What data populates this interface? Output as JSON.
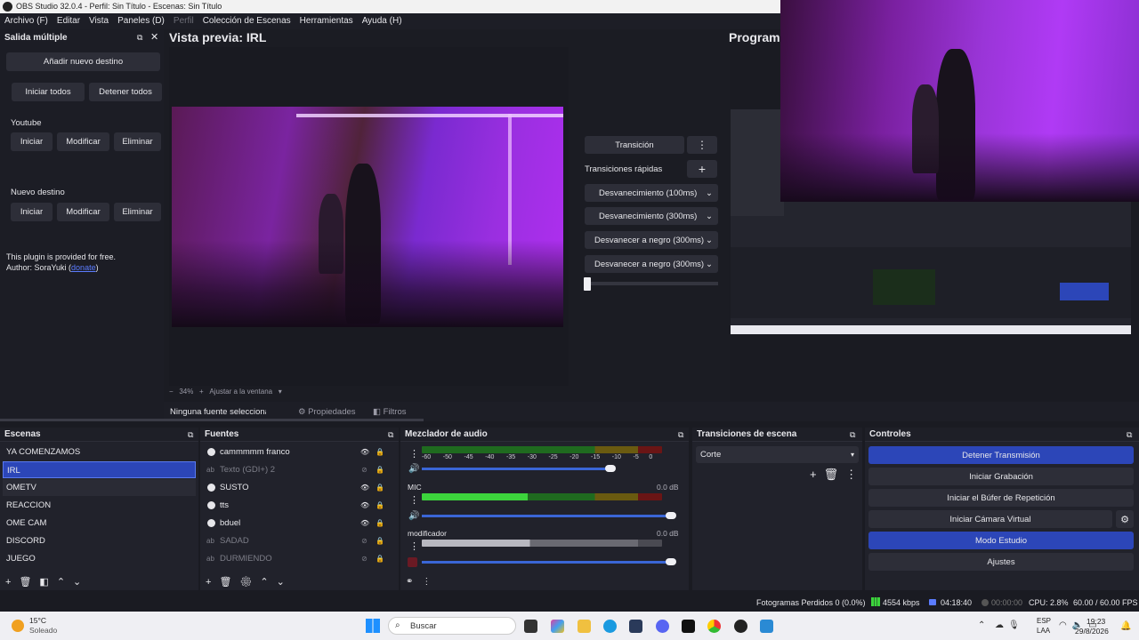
{
  "window": {
    "title": "OBS Studio 32.0.4 - Perfil: Sin Título - Escenas: Sin Título"
  },
  "menu": [
    "Archivo (F)",
    "Editar",
    "Vista",
    "Paneles (D)",
    "Perfil",
    "Colección de Escenas",
    "Herramientas",
    "Ayuda (H)"
  ],
  "multi_output": {
    "title": "Salida múltiple",
    "add_label": "Añadir nuevo destino",
    "start_all": "Iniciar todos",
    "stop_all": "Detener todos",
    "targets": [
      {
        "name": "Youtube",
        "start": "Iniciar",
        "modify": "Modificar",
        "remove": "Eliminar"
      },
      {
        "name": "Nuevo destino",
        "start": "Iniciar",
        "modify": "Modificar",
        "remove": "Eliminar"
      }
    ],
    "note1": "This plugin is provided for free.",
    "note2": "Author: SoraYuki (",
    "donate": "donate",
    "note_end": ")"
  },
  "preview": {
    "title": "Vista previa: IRL",
    "zoom": "34%",
    "fit": "Ajustar a la ventana"
  },
  "program": {
    "title": "Program"
  },
  "transition_center": {
    "transition": "Transición",
    "quick": "Transiciones rápidas",
    "items": [
      "Desvanecimiento (100ms)",
      "Desvanecimiento (300ms)",
      "Desvanecer a negro (300ms)",
      "Desvanecer a negro (300ms)"
    ]
  },
  "source_bar": {
    "none": "Ninguna fuente seleccionad",
    "properties": "Propiedades",
    "filters": "Filtros"
  },
  "scenes": {
    "title": "Escenas",
    "items": [
      "YA COMENZAMOS",
      "IRL",
      "OMETV",
      "REACCION",
      "OME CAM",
      "DISCORD",
      "JUEGO"
    ],
    "selected": 1
  },
  "sources": {
    "title": "Fuentes",
    "items": [
      "cammmmm franco",
      "Texto (GDI+) 2",
      "SUSTO",
      "tts",
      "bduel",
      "SADAD",
      "DURMIENDO"
    ]
  },
  "mixer": {
    "title": "Mezclador de audio",
    "ticks": [
      "-60",
      "-50",
      "-45",
      "-40",
      "-35",
      "-30",
      "-25",
      "-20",
      "-15",
      "-10",
      "-5",
      "0"
    ],
    "channels": [
      {
        "name": "",
        "db": ""
      },
      {
        "name": "MIC",
        "db": "0.0 dB"
      },
      {
        "name": "modificador",
        "db": "0.0 dB"
      }
    ]
  },
  "scene_transitions": {
    "title": "Transiciones de escena",
    "type": "Corte"
  },
  "controls": {
    "title": "Controles",
    "stop_stream": "Detener Transmisión",
    "start_record": "Iniciar Grabación",
    "replay": "Iniciar el Búfer de Repetición",
    "virtual_cam": "Iniciar Cámara Virtual",
    "studio": "Modo Estudio",
    "settings": "Ajustes"
  },
  "status": {
    "dropped": "Fotogramas Perdidos 0 (0.0%)",
    "bitrate": "4554 kbps",
    "stream_time": "04:18:40",
    "rec_time": "00:00:00",
    "cpu": "CPU: 2.8%",
    "fps": "60.00 / 60.00 FPS"
  },
  "taskbar": {
    "temp": "15°C",
    "weather": "Soleado",
    "search": "Buscar",
    "lang1": "ESP",
    "lang2": "LAA",
    "time": "19:23",
    "date": "29/8/2026"
  },
  "colors": {
    "accent": "#2c46b8",
    "bg": "#1a1b22",
    "panel": "#21222b"
  }
}
